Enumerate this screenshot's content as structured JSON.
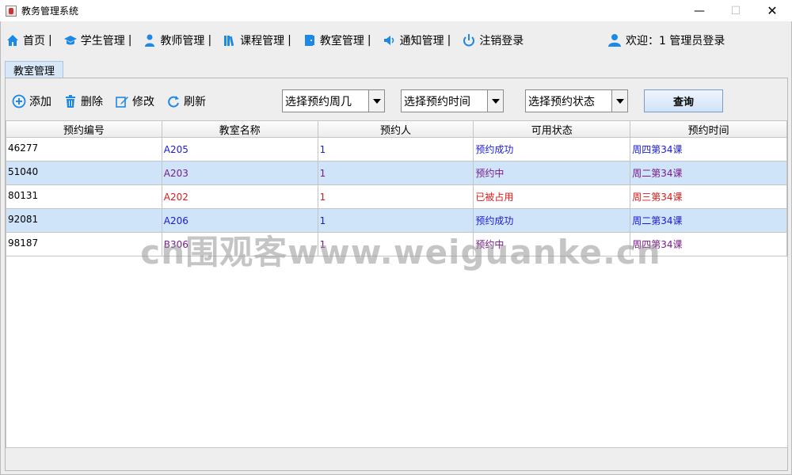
{
  "window": {
    "title": "教务管理系统",
    "controls": {
      "minimize": "—",
      "maximize": "☐",
      "close": "✕"
    }
  },
  "menu": {
    "items": [
      {
        "label": "首页",
        "icon": "home-icon"
      },
      {
        "label": "学生管理",
        "icon": "graduation-cap-icon"
      },
      {
        "label": "教师管理",
        "icon": "teacher-icon"
      },
      {
        "label": "课程管理",
        "icon": "books-icon"
      },
      {
        "label": "教室管理",
        "icon": "door-icon"
      },
      {
        "label": "通知管理",
        "icon": "speaker-icon"
      },
      {
        "label": "注销登录",
        "icon": "power-icon"
      }
    ],
    "separator": "|",
    "welcome": "欢迎：1 管理员登录"
  },
  "tab": {
    "label": "教室管理"
  },
  "toolbar": {
    "add": "添加",
    "delete": "删除",
    "edit": "修改",
    "refresh": "刷新",
    "week_select": "选择预约周几",
    "time_select": "选择预约时间",
    "status_select": "选择预约状态",
    "query": "查询"
  },
  "table": {
    "columns": [
      "预约编号",
      "教室名称",
      "预约人",
      "可用状态",
      "预约时间"
    ],
    "rows": [
      {
        "id": "46277",
        "room": "A205",
        "person": "1",
        "status": "预约成功",
        "time": "周四第34课",
        "color": "#1a1adb",
        "selected": false
      },
      {
        "id": "51040",
        "room": "A203",
        "person": "1",
        "status": "预约中",
        "time": "周二第34课",
        "color": "#7a1a8c",
        "selected": true
      },
      {
        "id": "80131",
        "room": "A202",
        "person": "1",
        "status": "已被占用",
        "time": "周三第34课",
        "color": "#d81b1b",
        "selected": false
      },
      {
        "id": "92081",
        "room": "A206",
        "person": "1",
        "status": "预约成功",
        "time": "周二第34课",
        "color": "#1a1adb",
        "selected": true
      },
      {
        "id": "98187",
        "room": "B306",
        "person": "1",
        "status": "预约中",
        "time": "周四第34课",
        "color": "#7a1a8c",
        "selected": false
      }
    ]
  },
  "watermark": "cn围观客www.weiguanke.cn",
  "colors": {
    "accent": "#1e88e5",
    "selected_row": "#cfe4f9"
  }
}
